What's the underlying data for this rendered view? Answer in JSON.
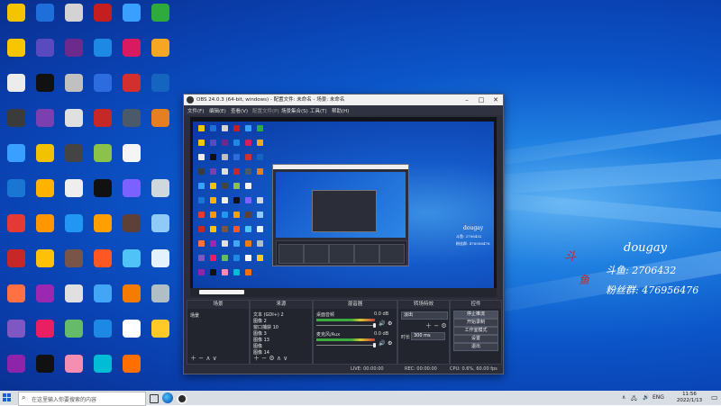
{
  "desktop": {
    "icon_colors": [
      [
        "#f5c400",
        "#1e6fd9",
        "#d3d3d3",
        "#c41e1e",
        "#3aa0ff",
        "#2faa3c"
      ],
      [
        "#f7c600",
        "#5a4ac0",
        "#6b2a8c",
        "#1e88e5",
        "#d81b60",
        "#f5a623"
      ],
      [
        "#ececec",
        "#111111",
        "#c0c0c0",
        "#2d6cdf",
        "#d32f2f",
        "#1565c0"
      ],
      [
        "#3b3b3b",
        "#7b3fb0",
        "#e0e0e0",
        "#c62828",
        "#4a5a6a",
        "#e67e22"
      ],
      [
        "#3aa0ff",
        "#f2c200",
        "#444444",
        "#8bc34a",
        "#f5f5f5"
      ],
      [
        "#1976d2",
        "#ffb300",
        "#eeeeee",
        "#111111",
        "#7b61ff",
        "#cfd8dc"
      ],
      [
        "#e53935",
        "#ff9800",
        "#2196f3",
        "#ffa000",
        "#5d4037",
        "#90caf9"
      ],
      [
        "#c62828",
        "#ffc107",
        "#795548",
        "#ff5722",
        "#4fc3f7",
        "#e3f2fd"
      ],
      [
        "#ff7043",
        "#9c27b0",
        "#e0e0e0",
        "#42a5f5",
        "#f57c00",
        "#b0bec5"
      ],
      [
        "#7e57c2",
        "#e91e63",
        "#66bb6a",
        "#1e88e5",
        "#ffffff",
        "#ffca28"
      ],
      [
        "#8e24aa",
        "#111111",
        "#f48fb1",
        "#00bcd4",
        "#ff6f00"
      ]
    ]
  },
  "obs": {
    "title": "OBS 24.0.3 (64-bit, windows) - 配置文件: 未命名 - 场景: 未命名",
    "menu": [
      "文件(F)",
      "编辑(E)",
      "查看(V)",
      "配置文件(P)",
      "场景集合(S)",
      "工具(T)",
      "帮助(H)"
    ],
    "preview_text": {
      "name": "dougay",
      "line1": "斗鱼: 2706432",
      "line2": "粉丝群: 476956476"
    },
    "docks": {
      "scenes": {
        "header": "场景",
        "items": [
          "场景"
        ]
      },
      "sources": {
        "header": "来源",
        "items": [
          "文本 (GDI+) 2",
          "图像 2",
          "窗口捕获 10",
          "图像 3",
          "图像 13",
          "图像",
          "图像 14"
        ]
      },
      "mixer": {
        "header": "混音器",
        "channels": [
          {
            "name": "桌面音频",
            "db": "0.0 dB"
          },
          {
            "name": "麦克风/Aux",
            "db": "0.0 dB"
          }
        ]
      },
      "transitions": {
        "header": "转场特效",
        "type": "淡出",
        "duration_label": "时长",
        "duration": "300 ms"
      },
      "controls": {
        "header": "控件",
        "buttons": [
          "停止推流",
          "开始录制",
          "工作室模式",
          "设置",
          "退出"
        ]
      }
    },
    "status": {
      "live": "LIVE: 00:00:00",
      "rec": "REC: 00:00:00",
      "cpu": "CPU: 0.6%, 60.00 fps"
    }
  },
  "overlay": {
    "name": "dougay",
    "line1": "斗鱼: 2706432",
    "line2": "粉丝群: 476956476"
  },
  "taskbar": {
    "search_placeholder": "在这里输入你要搜索的内容",
    "tray_lang": "ENG",
    "time": "11:56",
    "date": "2022/1/13"
  }
}
